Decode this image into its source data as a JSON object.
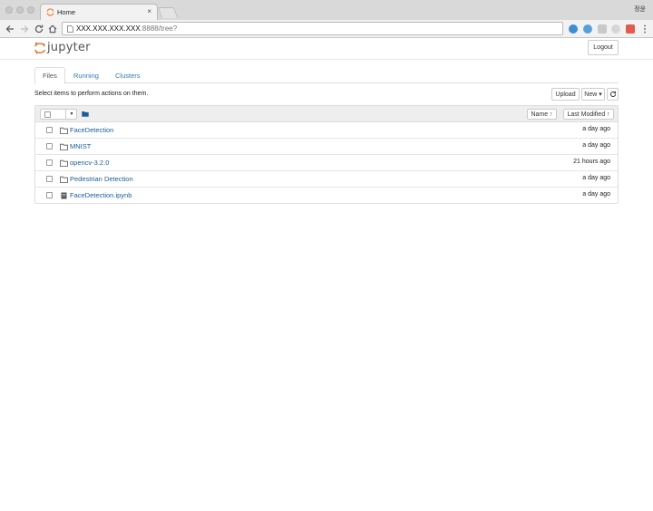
{
  "browser": {
    "tab_title": "Home",
    "tab_close": "×",
    "profile_name": "정윤",
    "url_host": "XXX.XXX.XXX.XXX",
    "url_path": ":8888/tree?"
  },
  "header": {
    "logo_text": "jupyter",
    "logout_label": "Logout"
  },
  "tabs": [
    {
      "label": "Files"
    },
    {
      "label": "Running"
    },
    {
      "label": "Clusters"
    }
  ],
  "toolbar": {
    "instructions": "Select items to perform actions on them.",
    "upload_label": "Upload",
    "new_label": "New ▾",
    "refresh_icon": "refresh-icon"
  },
  "list_header": {
    "name_sort_label": "Name ↑",
    "modified_sort_label": "Last Modified ↑"
  },
  "files": [
    {
      "name": "FaceDetection",
      "type": "folder",
      "modified": "a day ago"
    },
    {
      "name": "MNIST",
      "type": "folder",
      "modified": "a day ago"
    },
    {
      "name": "opencv-3.2.0",
      "type": "folder",
      "modified": "21 hours ago"
    },
    {
      "name": "Pedestrian Detection",
      "type": "folder",
      "modified": "a day ago"
    },
    {
      "name": "FaceDetection.ipynb",
      "type": "notebook",
      "modified": "a day ago"
    }
  ],
  "colors": {
    "link": "#1a5d99",
    "tab_link": "#337ab7",
    "jupyter_orange": "#f37626"
  }
}
